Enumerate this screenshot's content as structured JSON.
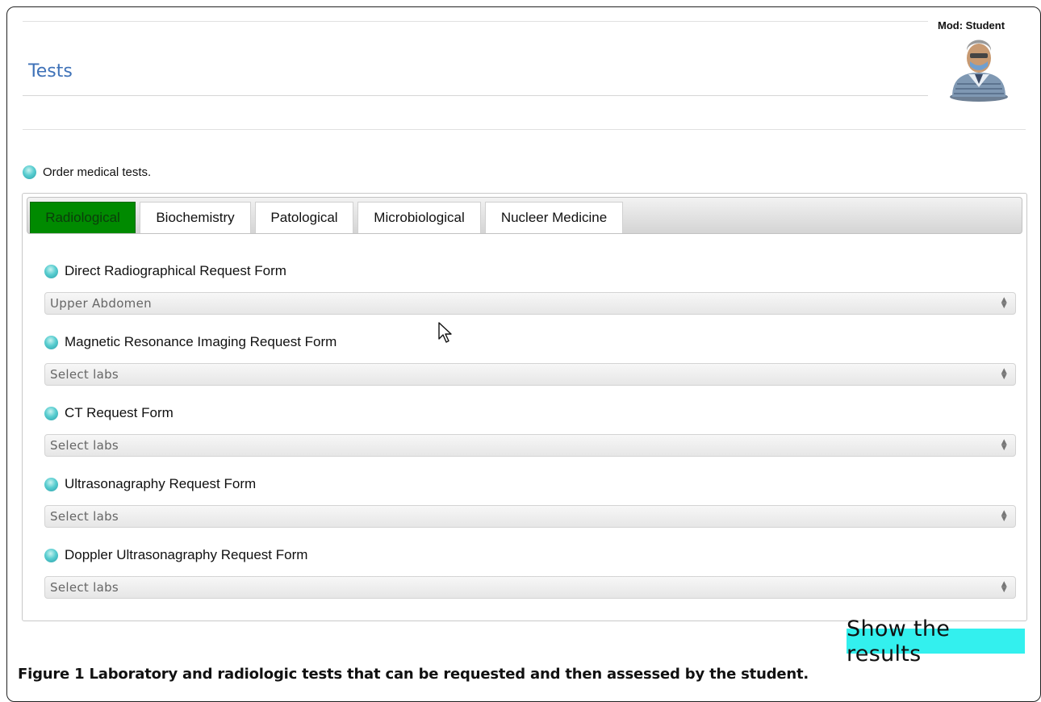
{
  "header": {
    "title": "Tests",
    "mod_label": "Mod: Student"
  },
  "order": {
    "label": "Order medical tests."
  },
  "tabs": [
    {
      "label": "Radiological",
      "active": true
    },
    {
      "label": "Biochemistry",
      "active": false
    },
    {
      "label": "Patological",
      "active": false
    },
    {
      "label": "Microbiological",
      "active": false
    },
    {
      "label": "Nucleer Medicine",
      "active": false
    }
  ],
  "forms": [
    {
      "label": "Direct Radiographical Request Form",
      "selected": "Upper Abdomen"
    },
    {
      "label": "Magnetic Resonance Imaging Request Form",
      "selected": "Select labs"
    },
    {
      "label": "CT Request Form",
      "selected": "Select labs"
    },
    {
      "label": "Ultrasonagraphy Request Form",
      "selected": "Select labs"
    },
    {
      "label": "Doppler Ultrasonagraphy Request Form",
      "selected": "Select labs"
    }
  ],
  "actions": {
    "show_results": "Show the results"
  },
  "caption": {
    "text": "Figure 1 Laboratory and radiologic tests that can be requested and then assessed by the student."
  },
  "colors": {
    "active_tab": "#008a00",
    "show_results_bg": "#33f0ee",
    "title": "#3f72b8"
  },
  "icons": {
    "bullet": "cyan-bullet-icon",
    "avatar": "student-avatar-icon",
    "select_arrow": "updown-arrows-icon",
    "cursor": "mouse-pointer-icon"
  }
}
